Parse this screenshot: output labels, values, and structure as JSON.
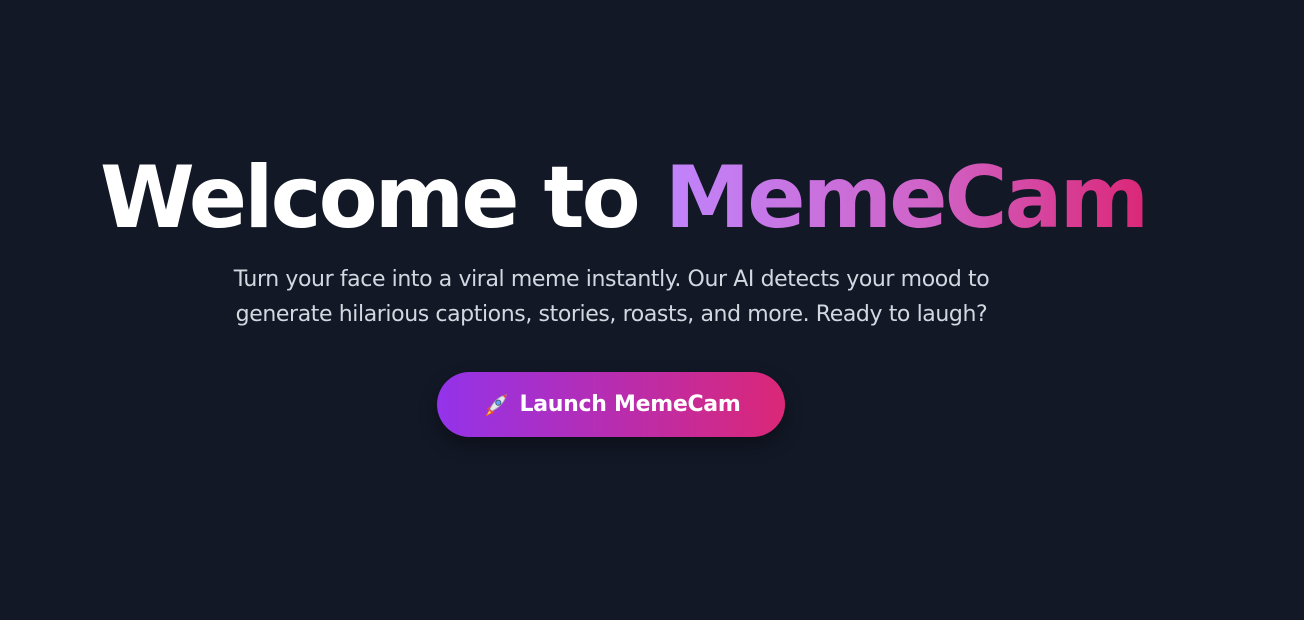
{
  "hero": {
    "title_prefix": "Welcome to ",
    "title_brand": "MemeCam",
    "subtitle_line1": "Turn your face into a viral meme instantly. Our AI detects your mood to",
    "subtitle_line2": "generate hilarious captions, stories, roasts, and more. Ready to laugh?",
    "launch_button": {
      "icon": "rocket-icon",
      "label": "Launch MemeCam"
    }
  },
  "colors": {
    "background": "#121826",
    "title_text": "#ffffff",
    "subtitle_text": "#d3d7e0",
    "brand_gradient_start": "#c084fc",
    "brand_gradient_end": "#db2777",
    "button_gradient_start": "#9333ea",
    "button_gradient_end": "#db2777"
  }
}
